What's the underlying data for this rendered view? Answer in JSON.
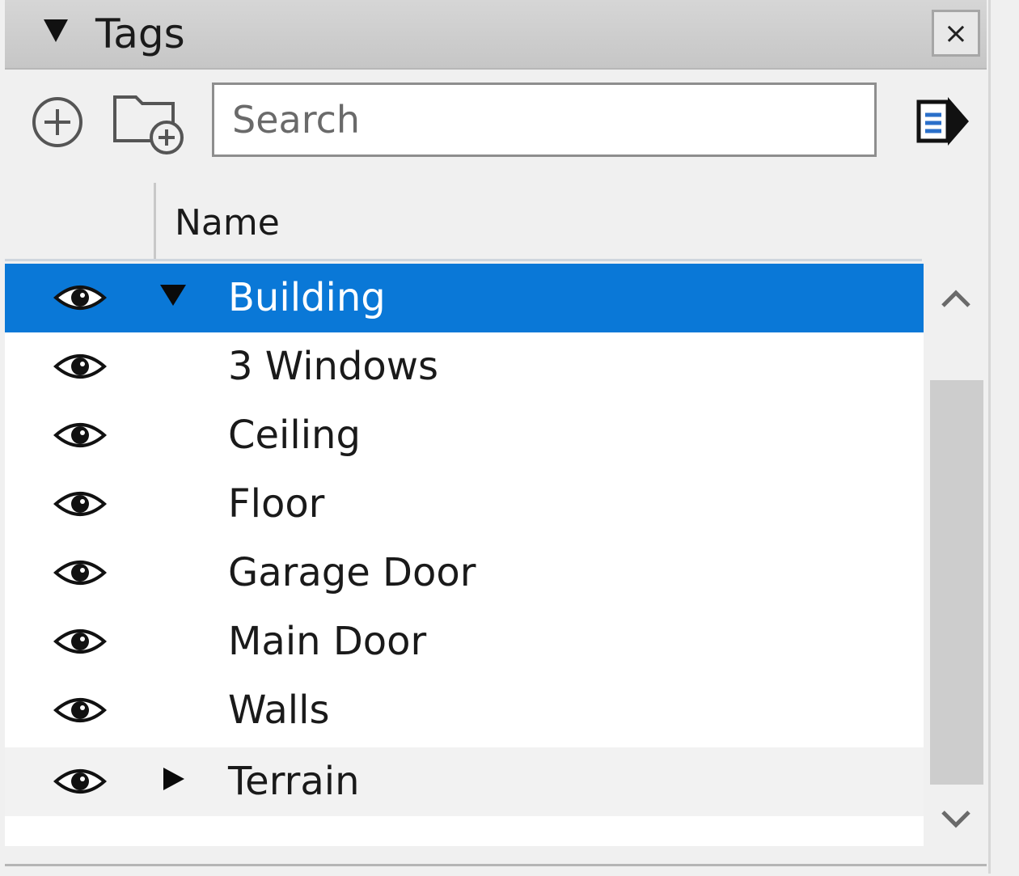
{
  "panel": {
    "title": "Tags",
    "close_label": "×"
  },
  "toolbar": {
    "add_icon": "add-tag-icon",
    "folder_icon": "add-folder-icon",
    "export_icon": "details-export-icon"
  },
  "search": {
    "placeholder": "Search",
    "value": ""
  },
  "table": {
    "column_name": "Name"
  },
  "rows": [
    {
      "label": "Building",
      "selected": true,
      "expander": "expanded",
      "visible": true
    },
    {
      "label": "3 Windows",
      "selected": false,
      "expander": "none",
      "visible": true
    },
    {
      "label": "Ceiling",
      "selected": false,
      "expander": "none",
      "visible": true
    },
    {
      "label": "Floor",
      "selected": false,
      "expander": "none",
      "visible": true
    },
    {
      "label": "Garage Door",
      "selected": false,
      "expander": "none",
      "visible": true
    },
    {
      "label": "Main Door",
      "selected": false,
      "expander": "none",
      "visible": true
    },
    {
      "label": "Walls",
      "selected": false,
      "expander": "none",
      "visible": true
    },
    {
      "label": "Terrain",
      "selected": false,
      "expander": "collapsed",
      "visible": true
    }
  ],
  "colors": {
    "selection": "#0a78d7",
    "selection_text": "#ffffff"
  }
}
